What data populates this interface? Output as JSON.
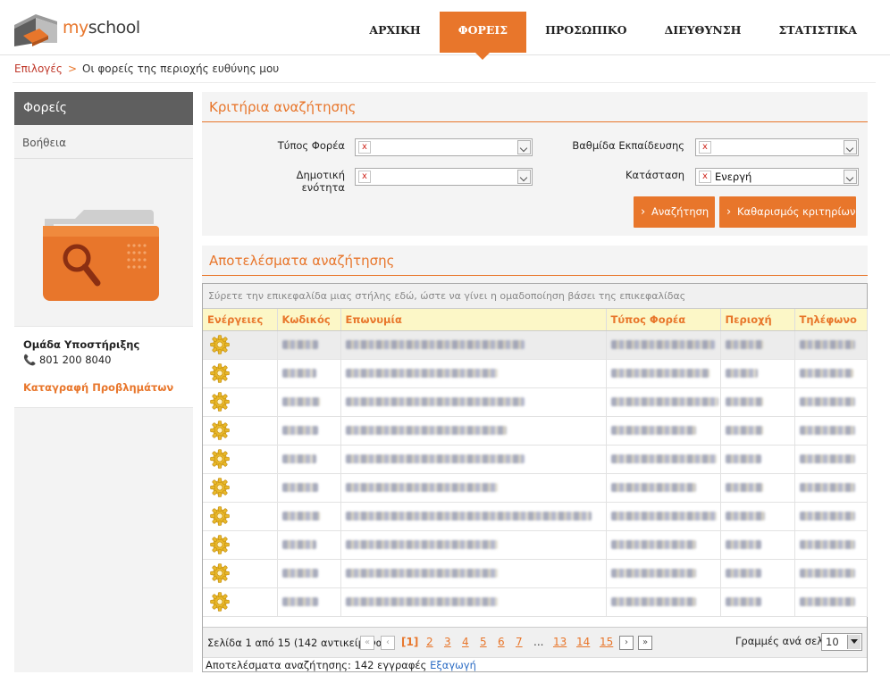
{
  "app": {
    "logo_prefix": "my",
    "logo_suffix": "school"
  },
  "nav": {
    "items": [
      {
        "label": "ΑΡΧΙΚΗ",
        "active": false
      },
      {
        "label": "ΦΟΡΕΙΣ",
        "active": true
      },
      {
        "label": "ΠΡΟΣΩΠΙΚΟ",
        "active": false
      },
      {
        "label": "ΔΙΕΥΘΥΝΣΗ",
        "active": false
      },
      {
        "label": "ΣΤΑΤΙΣΤΙΚΑ",
        "active": false
      }
    ]
  },
  "breadcrumb": {
    "root": "Επιλογές",
    "separator": ">",
    "current": "Οι φορείς της περιοχής ευθύνης μου"
  },
  "sidebar": {
    "header": "Φορείς",
    "help": "Βοήθεια",
    "folder_icon": "folder-search-icon",
    "support_title": "Ομάδα Υποστήριξης",
    "support_phone": "801 200 8040",
    "report_link": "Καταγραφή Προβλημάτων"
  },
  "criteria": {
    "title": "Κριτήρια αναζήτησης",
    "fields": {
      "type_label": "Τύπος Φορέα",
      "type_value": "",
      "level_label": "Βαθμίδα Εκπαίδευσης",
      "level_value": "",
      "municipal_label": "Δημοτική ενότητα",
      "municipal_value": "",
      "status_label": "Κατάσταση",
      "status_value": "Ενεργή"
    },
    "clear_glyph": "x",
    "search_button": "Αναζήτηση",
    "reset_button": "Καθαρισμός κριτηρίων"
  },
  "results": {
    "title": "Αποτελέσματα αναζήτησης",
    "group_hint": "Σύρετε την επικεφαλίδα μιας στήλης εδώ, ώστε να γίνει η ομαδοποίηση βάσει της επικεφαλίδας",
    "columns": [
      "Ενέργειες",
      "Κωδικός",
      "Επωνυμία",
      "Τύπος Φορέα",
      "Περιοχή",
      "Τηλέφωνο"
    ],
    "row_count": 10,
    "action_icon": "gear-icon",
    "pager": {
      "info": "Σελίδα 1 από 15 (142 αντικείμενα)",
      "first": "«",
      "prev": "‹",
      "next": "›",
      "last": "»",
      "current": "[1]",
      "pages": [
        "2",
        "3",
        "4",
        "5",
        "6",
        "7"
      ],
      "dots": "...",
      "tail_pages": [
        "13",
        "14",
        "15"
      ],
      "rows_label": "Γραμμές ανά σελίδα",
      "rows_value": "10"
    },
    "summary": "Αποτελέσματα αναζήτησης: 142 εγγραφές",
    "export": "Εξαγωγή"
  },
  "colors": {
    "accent": "#e8762b",
    "sidebar_header": "#5f5f5f",
    "header_row": "#fcf7c7"
  }
}
